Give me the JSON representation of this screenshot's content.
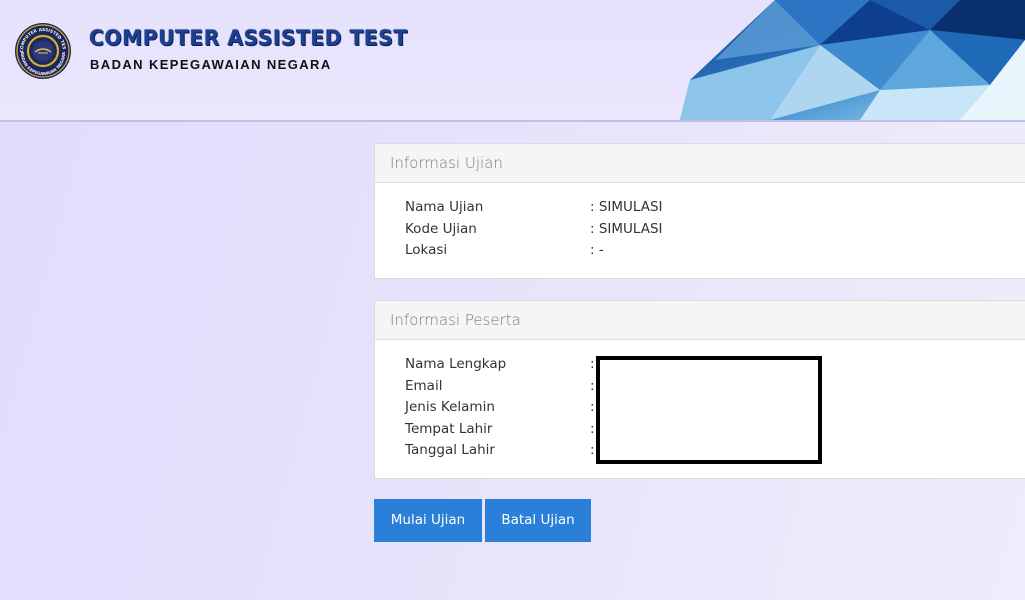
{
  "header": {
    "title": "COMPUTER ASSISTED TEST",
    "subtitle": "BADAN KEPEGAWAIAN NEGARA",
    "logo_text_top": "COMPUTER ASSISTED TEST",
    "logo_text_bottom": "BADAN KEPEGAWAIAN NEGARA"
  },
  "exam_info": {
    "heading": "Informasi Ujian",
    "rows": [
      {
        "label": "Nama Ujian",
        "value": ": SIMULASI"
      },
      {
        "label": "Kode Ujian",
        "value": ": SIMULASI"
      },
      {
        "label": "Lokasi",
        "value": ": -"
      }
    ]
  },
  "participant_info": {
    "heading": "Informasi Peserta",
    "rows": [
      {
        "label": "Nama Lengkap",
        "value": ":"
      },
      {
        "label": "Email",
        "value": ":"
      },
      {
        "label": "Jenis Kelamin",
        "value": ":"
      },
      {
        "label": "Tempat Lahir",
        "value": ":"
      },
      {
        "label": "Tanggal Lahir",
        "value": ":"
      }
    ]
  },
  "actions": {
    "start_label": "Mulai Ujian",
    "cancel_label": "Batal Ujian"
  },
  "colors": {
    "primary_button": "#2a80d9",
    "brand_title": "#1d3f8f",
    "background": "#e6e2fb"
  }
}
